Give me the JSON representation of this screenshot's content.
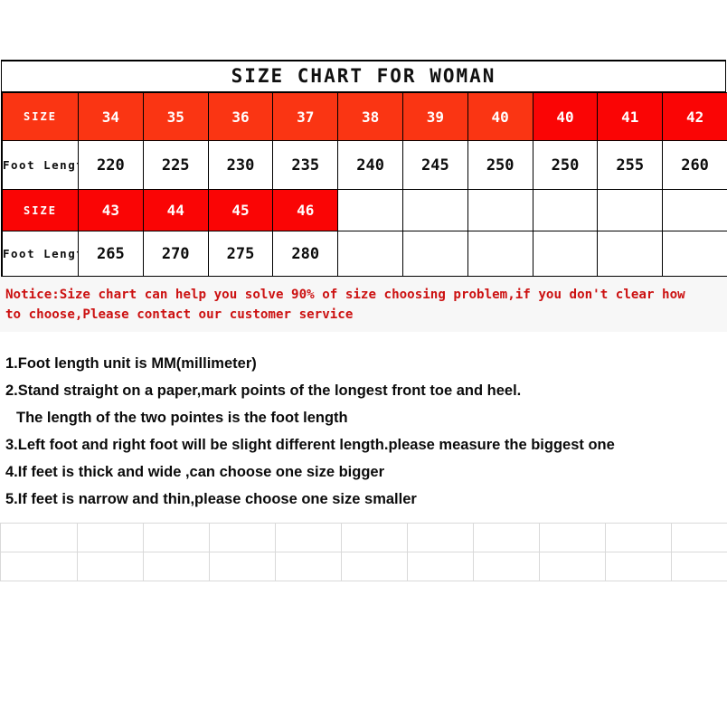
{
  "chart_data": {
    "type": "table",
    "title": "SIZE CHART FOR WOMAN",
    "row_labels": {
      "size": "SIZE",
      "foot_length": "Foot Length"
    },
    "block1": {
      "sizes": [
        "34",
        "35",
        "36",
        "37",
        "38",
        "39",
        "40",
        "40",
        "41",
        "42"
      ],
      "foot_lengths": [
        "220",
        "225",
        "230",
        "235",
        "240",
        "245",
        "250",
        "250",
        "255",
        "260"
      ]
    },
    "block2": {
      "sizes": [
        "43",
        "44",
        "45",
        "46",
        "",
        "",
        "",
        "",
        "",
        ""
      ],
      "foot_lengths": [
        "265",
        "270",
        "275",
        "280",
        "",
        "",
        "",
        "",
        "",
        ""
      ]
    },
    "colors": {
      "header_orange": "#FA3513",
      "header_red": "#FA0505",
      "notice_text": "#CC1111",
      "notice_background": "#F7F7F7",
      "grid_line": "#D9D9D9",
      "table_border": "#000000"
    }
  },
  "notice": {
    "line1": "Notice:Size chart can help you solve 90% of size choosing problem,if you don't clear how",
    "line2": "to choose,Please contact our customer service"
  },
  "instructions": [
    "1.Foot length unit is MM(millimeter)",
    "2.Stand straight on a paper,mark points of the longest front toe and heel.",
    "The length of the two pointes is the foot length",
    "3.Left foot and right foot will be slight different length.please measure the biggest one",
    "4.If feet is thick and wide ,can choose one size bigger",
    "5.If feet is narrow and thin,please choose one size smaller"
  ]
}
